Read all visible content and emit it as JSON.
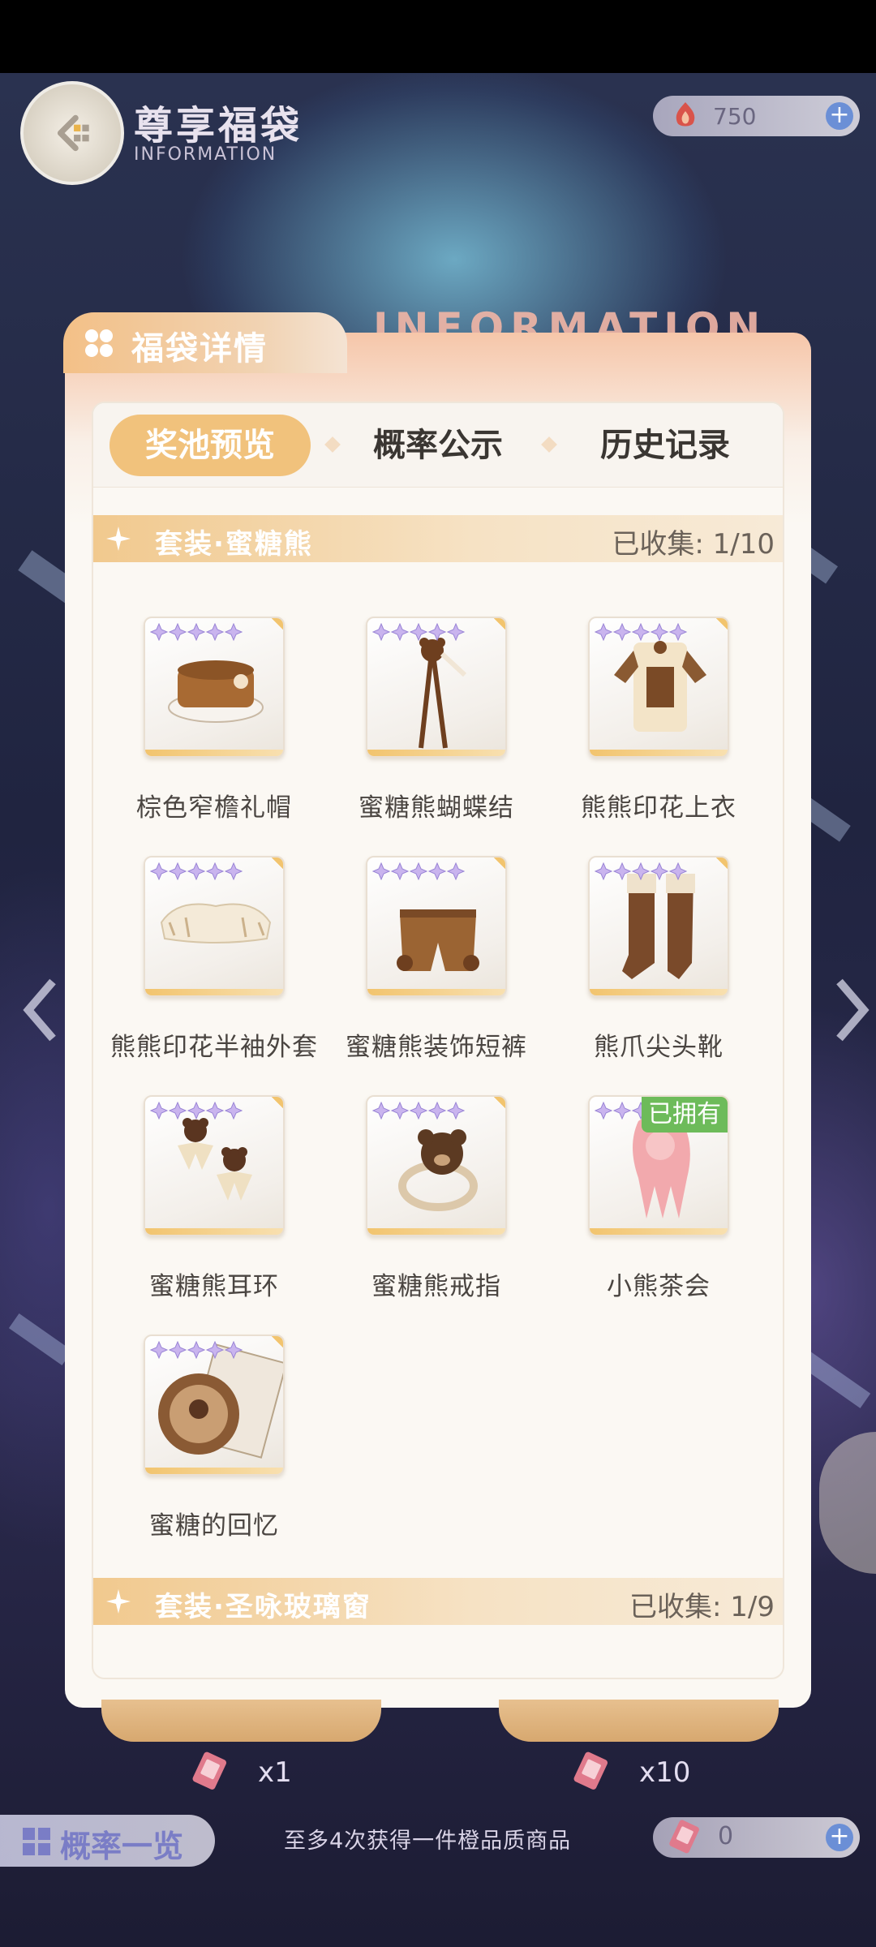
{
  "header": {
    "title": "尊享福袋",
    "subtitle": "INFORMATION",
    "currency_value": "750",
    "plus": "+"
  },
  "watermark": "INFORMATION",
  "panel": {
    "title": "福袋详情",
    "tabs": [
      {
        "label": "奖池预览",
        "active": true
      },
      {
        "label": "概率公示",
        "active": false
      },
      {
        "label": "历史记录",
        "active": false
      }
    ],
    "sections": [
      {
        "name": "套装·蜜糖熊",
        "collected_label": "已收集:",
        "collected_value": "1/10"
      },
      {
        "name": "套装·圣咏玻璃窗",
        "collected_label": "已收集:",
        "collected_value": "1/9"
      }
    ],
    "items": [
      {
        "name": "棕色窄檐礼帽",
        "icon": "hat-icon"
      },
      {
        "name": "蜜糖熊蝴蝶结",
        "icon": "bow-icon"
      },
      {
        "name": "熊熊印花上衣",
        "icon": "top-icon"
      },
      {
        "name": "熊熊印花半袖外套",
        "icon": "jacket-icon"
      },
      {
        "name": "蜜糖熊装饰短裤",
        "icon": "shorts-icon"
      },
      {
        "name": "熊爪尖头靴",
        "icon": "boots-icon"
      },
      {
        "name": "蜜糖熊耳环",
        "icon": "earrings-icon"
      },
      {
        "name": "蜜糖熊戒指",
        "icon": "ring-icon"
      },
      {
        "name": "小熊茶会",
        "icon": "hair-icon",
        "badge": "已拥有"
      },
      {
        "name": "蜜糖的回忆",
        "icon": "memory-icon"
      }
    ]
  },
  "bottom": {
    "draw_once_qty": "x1",
    "draw_ten_qty": "x10",
    "probability_button": "概率一览",
    "notice": "至多4次获得一件橙品质商品",
    "ticket_count": "0",
    "plus": "+"
  },
  "colors": {
    "accent": "#f1c27c",
    "owned_badge": "#6dbb5a",
    "plus_button": "#6b8fd6"
  }
}
